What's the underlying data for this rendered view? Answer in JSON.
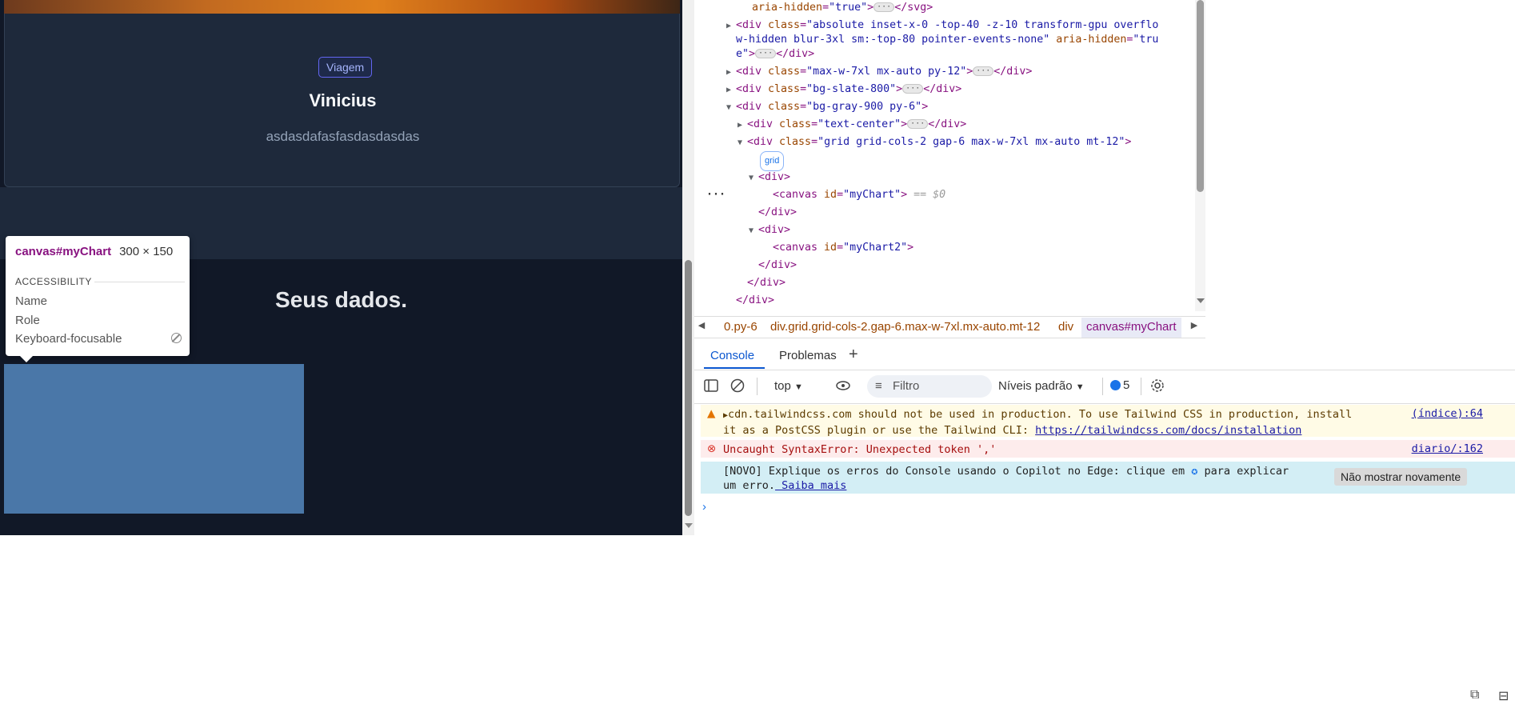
{
  "page": {
    "card": {
      "badge": "Viagem",
      "title": "Vinicius",
      "description": "asdasdafasfasdasdasdas"
    },
    "section_title": "Seus dados."
  },
  "tooltip": {
    "element": "canvas#myChart",
    "size": "300 × 150",
    "section": "ACCESSIBILITY",
    "rows": [
      "Name",
      "Role",
      "Keyboard-focusable"
    ]
  },
  "elements": {
    "lines": [
      {
        "a": "aria-hidden",
        "v": "\"true\""
      },
      {
        "text1": "absolute inset-x-0 -top-40 -z-10 transform-gpu overflo",
        "text2": "w-hidden blur-3xl sm:-top-80 pointer-events-none",
        "a": "aria-hidden",
        "v3": "\"tru",
        "v4": "e\""
      },
      {
        "cls": "\"max-w-7xl mx-auto py-12\""
      },
      {
        "cls": "\"bg-slate-800\""
      },
      {
        "cls": "\"bg-gray-900 py-6\""
      },
      {
        "cls": "\"text-center\""
      },
      {
        "cls": "\"grid grid-cols-2 gap-6 max-w-7xl mx-auto mt-12\""
      },
      {
        "badge": "grid"
      },
      {
        "tag": "<div>"
      },
      {
        "id": "\"myChart\"",
        "dollar": "== $0"
      },
      {
        "tag": "</div>"
      },
      {
        "tag": "<div>"
      },
      {
        "id": "\"myChart2\""
      },
      {
        "tag": "</div>"
      },
      {
        "tag": "</div>"
      },
      {
        "tag": "</div>"
      }
    ]
  },
  "breadcrumbs": [
    "0.py-6",
    "div.grid.grid-cols-2.gap-6.max-w-7xl.mx-auto.mt-12",
    "div",
    "canvas#myChart"
  ],
  "console_tabs": [
    "Console",
    "Problemas"
  ],
  "toolbar": {
    "context": "top",
    "filter_placeholder": "Filtro",
    "levels": "Níveis padrão",
    "issues_count": "5"
  },
  "messages": {
    "warning": {
      "line1": "cdn.tailwindcss.com should not be used in production. To use Tailwind CSS in production, install",
      "line2": "it as a PostCSS plugin or use the Tailwind CLI:",
      "link": "https://tailwindcss.com/docs/installation",
      "source": "(índice):64"
    },
    "error": {
      "text": "Uncaught SyntaxError: Unexpected token ','",
      "source": "diario/:162"
    },
    "info": {
      "line1": "[NOVO] Explique os erros do Console usando o Copilot no Edge: clique em",
      "line1b": "para explicar",
      "line2": "um erro.",
      "link": " Saiba mais",
      "button": "Não mostrar novamente"
    }
  },
  "colors": {
    "page_bg": "#111827",
    "card_bg": "#1e293b",
    "canvas_highlight": "#4a77a8",
    "selected_row": "#cfe8fc"
  }
}
